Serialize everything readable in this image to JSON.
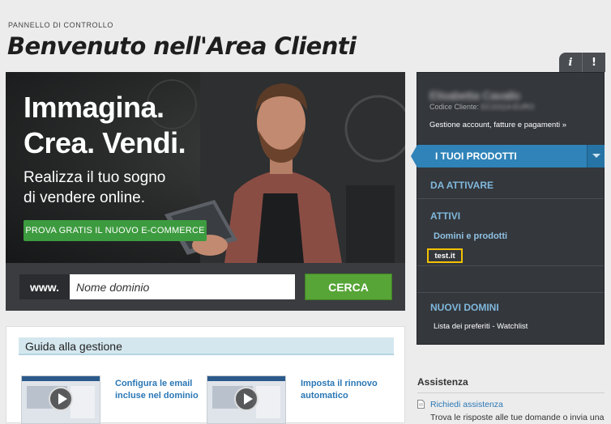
{
  "header": {
    "breadcrumb": "PANNELLO DI CONTROLLO",
    "title": "Benvenuto nell'Area Clienti",
    "info_tab": "i",
    "alert_tab": "!"
  },
  "hero": {
    "headline_1": "Immagina",
    "headline_2a": "Crea",
    "headline_2b": "Vendi",
    "headline_dot": ".",
    "sub_1": "Realizza il tuo sogno",
    "sub_2": "di vendere online.",
    "cta": "PROVA GRATIS IL NUOVO E-COMMERCE"
  },
  "domain_search": {
    "prefix": "www.",
    "placeholder": "Nome dominio",
    "button": "CERCA"
  },
  "guide": {
    "title": "Guida alla gestione",
    "videos": [
      {
        "line1": "Configura le email",
        "line2": "incluse nel dominio",
        "icon": "play-icon"
      },
      {
        "line1": "Imposta il rinnovo",
        "line2": "automatico",
        "icon": "play-icon"
      }
    ]
  },
  "account": {
    "name": "Elisabetta Cavallo",
    "code_label": "Codice Cliente:",
    "code_value": "EC10114-EURO",
    "manage_link": "Gestione account, fatture e pagamenti »",
    "products_tab": "I TUOI PRODOTTI",
    "to_activate": "DA ATTIVARE",
    "active": "ATTIVI",
    "domains_products": "Domini e prodotti",
    "selected_domain": "test.it",
    "new_domains": "NUOVI DOMINI",
    "watchlist": "Lista dei preferiti - Watchlist"
  },
  "assistance": {
    "title": "Assistenza",
    "link": "Richiedi assistenza",
    "text": "Trova le risposte alle tue domande o invia una"
  },
  "colors": {
    "accent_blue": "#2f83b8",
    "cta_green": "#3d9b3f",
    "highlight": "#f2c100",
    "sidebar_bg": "#34373c"
  }
}
